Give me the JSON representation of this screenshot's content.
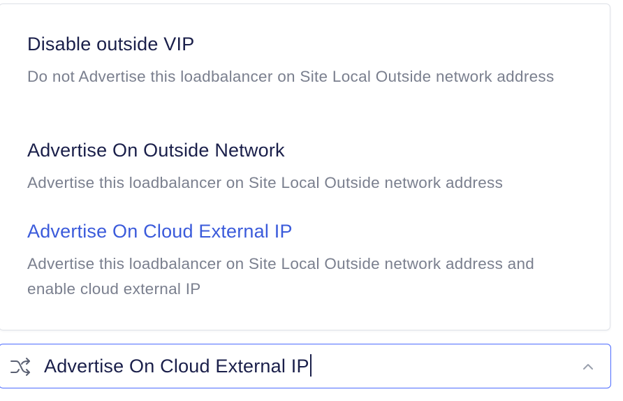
{
  "dropdown": {
    "options": [
      {
        "title": "Disable outside VIP",
        "description": "Do not Advertise this loadbalancer on Site Local Outside network address",
        "selected": false
      },
      {
        "title": "Advertise On Outside Network",
        "description": "Advertise this loadbalancer on Site Local Outside network address",
        "selected": false
      },
      {
        "title": "Advertise On Cloud External IP",
        "description": "Advertise this loadbalancer on Site Local Outside network address and enable cloud external IP",
        "selected": true
      }
    ]
  },
  "select_field": {
    "icon": "route-split-icon",
    "value": "Advertise On Cloud External IP",
    "chevron": "chevron-up-icon"
  },
  "colors": {
    "selected_text": "#3b5bdb",
    "focus_border": "#4d6bff",
    "title_text": "#1a1f4a",
    "description_text": "#7a7f8e"
  }
}
